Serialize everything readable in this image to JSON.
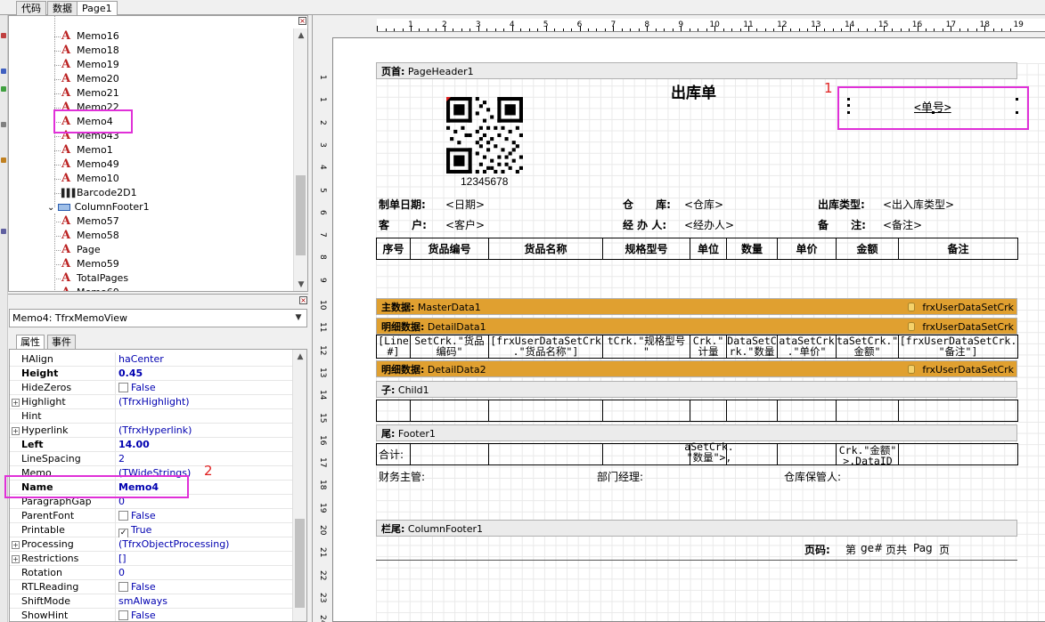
{
  "top_tabs": [
    "代码",
    "数据",
    "Page1"
  ],
  "tree": {
    "items": [
      {
        "label": "Memo16",
        "kind": "memo"
      },
      {
        "label": "Memo18",
        "kind": "memo"
      },
      {
        "label": "Memo19",
        "kind": "memo"
      },
      {
        "label": "Memo20",
        "kind": "memo"
      },
      {
        "label": "Memo21",
        "kind": "memo"
      },
      {
        "label": "Memo22",
        "kind": "memo"
      },
      {
        "label": "Memo4",
        "kind": "memo"
      },
      {
        "label": "Memo43",
        "kind": "memo"
      },
      {
        "label": "Memo1",
        "kind": "memo"
      },
      {
        "label": "Memo49",
        "kind": "memo"
      },
      {
        "label": "Memo10",
        "kind": "memo"
      },
      {
        "label": "Barcode2D1",
        "kind": "barcode"
      },
      {
        "label": "ColumnFooter1",
        "kind": "band"
      },
      {
        "label": "Memo57",
        "kind": "memo"
      },
      {
        "label": "Memo58",
        "kind": "memo"
      },
      {
        "label": "Page",
        "kind": "memo"
      },
      {
        "label": "Memo59",
        "kind": "memo"
      },
      {
        "label": "TotalPages",
        "kind": "memo"
      },
      {
        "label": "Memo60",
        "kind": "memo"
      }
    ]
  },
  "object_selector": "Memo4: TfrxMemoView",
  "prop_tabs": [
    "属性",
    "事件"
  ],
  "properties": [
    {
      "name": "HAlign",
      "value": "haCenter",
      "bold": false,
      "expander": false,
      "checkbox": null
    },
    {
      "name": "Height",
      "value": "0.45",
      "bold": true,
      "expander": false,
      "checkbox": null
    },
    {
      "name": "HideZeros",
      "value": "False",
      "bold": false,
      "expander": false,
      "checkbox": false
    },
    {
      "name": "Highlight",
      "value": "(TfrxHighlight)",
      "bold": false,
      "expander": true,
      "checkbox": null
    },
    {
      "name": "Hint",
      "value": "",
      "bold": false,
      "expander": false,
      "checkbox": null
    },
    {
      "name": "Hyperlink",
      "value": "(TfrxHyperlink)",
      "bold": false,
      "expander": true,
      "checkbox": null
    },
    {
      "name": "Left",
      "value": "14.00",
      "bold": true,
      "expander": false,
      "checkbox": null
    },
    {
      "name": "LineSpacing",
      "value": "2",
      "bold": false,
      "expander": false,
      "checkbox": null
    },
    {
      "name": "Memo",
      "value": "(TWideStrings)",
      "bold": false,
      "expander": false,
      "checkbox": null
    },
    {
      "name": "Name",
      "value": "Memo4",
      "bold": true,
      "expander": false,
      "checkbox": null
    },
    {
      "name": "ParagraphGap",
      "value": "0",
      "bold": false,
      "expander": false,
      "checkbox": null
    },
    {
      "name": "ParentFont",
      "value": "False",
      "bold": false,
      "expander": false,
      "checkbox": false
    },
    {
      "name": "Printable",
      "value": "True",
      "bold": false,
      "expander": false,
      "checkbox": true
    },
    {
      "name": "Processing",
      "value": "(TfrxObjectProcessing)",
      "bold": false,
      "expander": true,
      "checkbox": null
    },
    {
      "name": "Restrictions",
      "value": "[]",
      "bold": false,
      "expander": true,
      "checkbox": null
    },
    {
      "name": "Rotation",
      "value": "0",
      "bold": false,
      "expander": false,
      "checkbox": null
    },
    {
      "name": "RTLReading",
      "value": "False",
      "bold": false,
      "expander": false,
      "checkbox": false
    },
    {
      "name": "ShiftMode",
      "value": "smAlways",
      "bold": false,
      "expander": false,
      "checkbox": null
    },
    {
      "name": "ShowHint",
      "value": "False",
      "bold": false,
      "expander": false,
      "checkbox": false
    }
  ],
  "annotations": {
    "one": "1",
    "two": "2"
  },
  "ruler": {
    "h_labels": [
      "1",
      "2",
      "3",
      "4",
      "5",
      "6",
      "7",
      "8",
      "9",
      "10",
      "11",
      "12",
      "13",
      "14",
      "15",
      "16",
      "17",
      "18",
      "19"
    ],
    "v_labels": [
      "1",
      "1",
      "2",
      "3",
      "4",
      "5",
      "6",
      "7",
      "8",
      "9",
      "10",
      "11",
      "12",
      "13",
      "14",
      "15",
      "16",
      "17",
      "18",
      "19",
      "20",
      "21",
      "22",
      "23",
      "24"
    ]
  },
  "report": {
    "page_header_band": {
      "label": "页首:",
      "name": "PageHeader1"
    },
    "title": "出库单",
    "doc_no": "<单号>",
    "barcode_text": "12345678",
    "fields": {
      "date_label": "制单日期:",
      "date_value": "<日期>",
      "warehouse_label": "仓      库:",
      "warehouse_value": "<仓库>",
      "type_label": "出库类型:",
      "type_value": "<出入库类型>",
      "customer_label": "客      户:",
      "customer_value": "<客户>",
      "handler_label": "经 办 人:",
      "handler_value": "<经办人>",
      "remark_label": "备      注:",
      "remark_value": "<备注>"
    },
    "columns": [
      "序号",
      "货品编号",
      "货品名称",
      "规格型号",
      "单位",
      "数量",
      "单价",
      "金额",
      "备注"
    ],
    "master_band": {
      "label": "主数据:",
      "name": "MasterData1",
      "dataset": "frxUserDataSetCrk"
    },
    "detail_band1": {
      "label": "明细数据:",
      "name": "DetailData1",
      "dataset": "frxUserDataSetCrk"
    },
    "detail_cells": [
      "[Line\n#]",
      "SetCrk.\"货品\n编码\"",
      "[frxUserDataSetCrk\n.\"货品名称\"]",
      "tCrk.\"规格型号\n\"",
      "Crk.\"\n计量",
      "DataSetC\nrk.\"数量",
      "ataSetCrk\n.\"单价\"",
      "taSetCrk.\"\n金额\"",
      "[frxUserDataSetCrk.\n\"备注\"]"
    ],
    "detail_band2": {
      "label": "明细数据:",
      "name": "DetailData2",
      "dataset": "frxUserDataSetCrk"
    },
    "child_band": {
      "label": "子:",
      "name": "Child1"
    },
    "footer_band": {
      "label": "尾:",
      "name": "Footer1"
    },
    "footer_total_label": "合计:",
    "footer_qty": "aSetCrk.\n\"数量\">,",
    "footer_amount": "Crk.\"金额\"\n>,DataID",
    "signatures": {
      "finance": "财务主管:",
      "dept": "部门经理:",
      "keeper": "仓库保管人:"
    },
    "column_footer_band": {
      "label": "栏尾:",
      "name": "ColumnFooter1"
    },
    "page_footer": {
      "label": "页码:",
      "p1": "第",
      "p2": "ge#",
      "p3": "页共",
      "p4": "Pag",
      "p5": "页"
    }
  }
}
